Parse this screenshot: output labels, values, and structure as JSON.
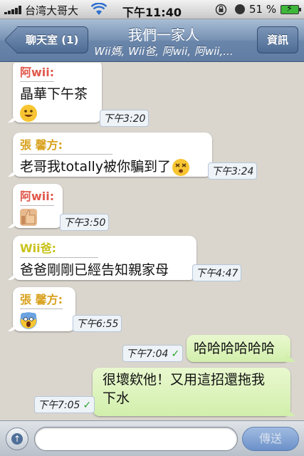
{
  "status_bar": {
    "carrier": "台湾大哥大",
    "time": "下午11:40",
    "battery_percent": "51 %"
  },
  "nav": {
    "back_label": "聊天室 (1)",
    "title": "我們一家人",
    "subtitle": "Wii媽, Wii爸, 阿wii, 阿wii,...",
    "info_label": "資訊"
  },
  "messages": [
    {
      "direction": "incoming",
      "sender": "阿wii:",
      "sender_color": "#e0584b",
      "text": "晶華下午茶",
      "emoji": "smiley",
      "time": "下午3:20"
    },
    {
      "direction": "incoming",
      "sender": "張 馨方:",
      "sender_color": "#d9a21f",
      "text": "老哥我totally被你騙到了",
      "emoji": "dizzy-face",
      "time": "下午3:24"
    },
    {
      "direction": "incoming",
      "sender": "阿wii:",
      "sender_color": "#e0584b",
      "text": "",
      "emoji": "thumbs-up",
      "time": "下午3:50"
    },
    {
      "direction": "incoming",
      "sender": "Wii爸:",
      "sender_color": "#c9c21a",
      "text": "爸爸剛剛已經告知親家母",
      "emoji": "",
      "time": "下午4:47"
    },
    {
      "direction": "incoming",
      "sender": "張 馨方:",
      "sender_color": "#d9a21f",
      "text": "",
      "emoji": "scream-face",
      "time": "下午6:55"
    },
    {
      "direction": "outgoing",
      "text": "哈哈哈哈哈哈",
      "time": "下午7:04"
    },
    {
      "direction": "outgoing",
      "text_line1": "很壞欸他！又用這招還拖我",
      "text_line2": "下水",
      "time": "下午7:05"
    }
  ],
  "input": {
    "placeholder": "",
    "send_label": "傳送"
  },
  "colors": {
    "nav_blue": "#6a86aa",
    "outgoing_bubble": "#d2efac",
    "background": "#dad6ce",
    "read_check": "#2aa32a"
  },
  "icons": [
    "signal-icon",
    "wifi-icon",
    "rotation-lock-icon",
    "alarm-icon",
    "battery-icon",
    "attach-icon"
  ]
}
